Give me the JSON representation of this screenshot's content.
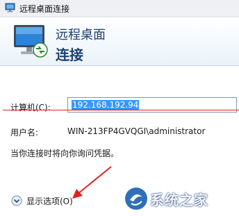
{
  "window": {
    "title": "远程桌面连接"
  },
  "banner": {
    "line1": "远程桌面",
    "line2": "连接"
  },
  "form": {
    "computer_label": "计算机(C):",
    "computer_value": "192.168.192.94",
    "user_label": "用户名:",
    "user_value": "WIN-213FP4GVQGI\\administrator",
    "hint": "当你连接时将向你询问凭据。"
  },
  "options": {
    "label": "显示选项(O)"
  },
  "watermark": {
    "text": "系统之家"
  },
  "colors": {
    "accent": "#1c3f75",
    "selection": "#3399ff",
    "annotation_red": "#e02020"
  },
  "icons": {
    "app": "remote-desktop-icon",
    "options_toggle": "chevron-down-icon"
  }
}
